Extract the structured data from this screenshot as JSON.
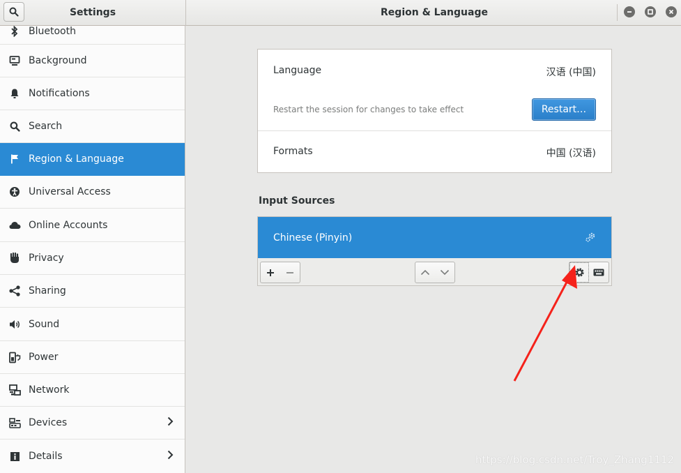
{
  "header": {
    "sidebar_title": "Settings",
    "panel_title": "Region & Language"
  },
  "sidebar": {
    "items": [
      {
        "label": "Bluetooth",
        "icon": "bluetooth-icon"
      },
      {
        "label": "Background",
        "icon": "background-icon"
      },
      {
        "label": "Notifications",
        "icon": "bell-icon"
      },
      {
        "label": "Search",
        "icon": "search-icon"
      },
      {
        "label": "Region & Language",
        "icon": "flag-icon",
        "selected": true
      },
      {
        "label": "Universal Access",
        "icon": "accessibility-icon"
      },
      {
        "label": "Online Accounts",
        "icon": "cloud-icon"
      },
      {
        "label": "Privacy",
        "icon": "hand-icon"
      },
      {
        "label": "Sharing",
        "icon": "share-icon"
      },
      {
        "label": "Sound",
        "icon": "speaker-icon"
      },
      {
        "label": "Power",
        "icon": "power-icon"
      },
      {
        "label": "Network",
        "icon": "network-icon"
      },
      {
        "label": "Devices",
        "icon": "devices-icon"
      },
      {
        "label": "Details",
        "icon": "info-icon"
      }
    ]
  },
  "main": {
    "language": {
      "label": "Language",
      "value": "汉语 (中国)"
    },
    "restart": {
      "hint": "Restart the session for changes to take effect",
      "button": "Restart…"
    },
    "formats": {
      "label": "Formats",
      "value": "中国 (汉语)"
    },
    "input_sources": {
      "title": "Input Sources",
      "items": [
        {
          "name": "Chinese (Pinyin)"
        }
      ]
    }
  },
  "watermark": "https://blog.csdn.net/Troy_Zhang1112",
  "colors": {
    "accent": "#2a8ad4",
    "annotation_arrow": "#f5221b"
  }
}
